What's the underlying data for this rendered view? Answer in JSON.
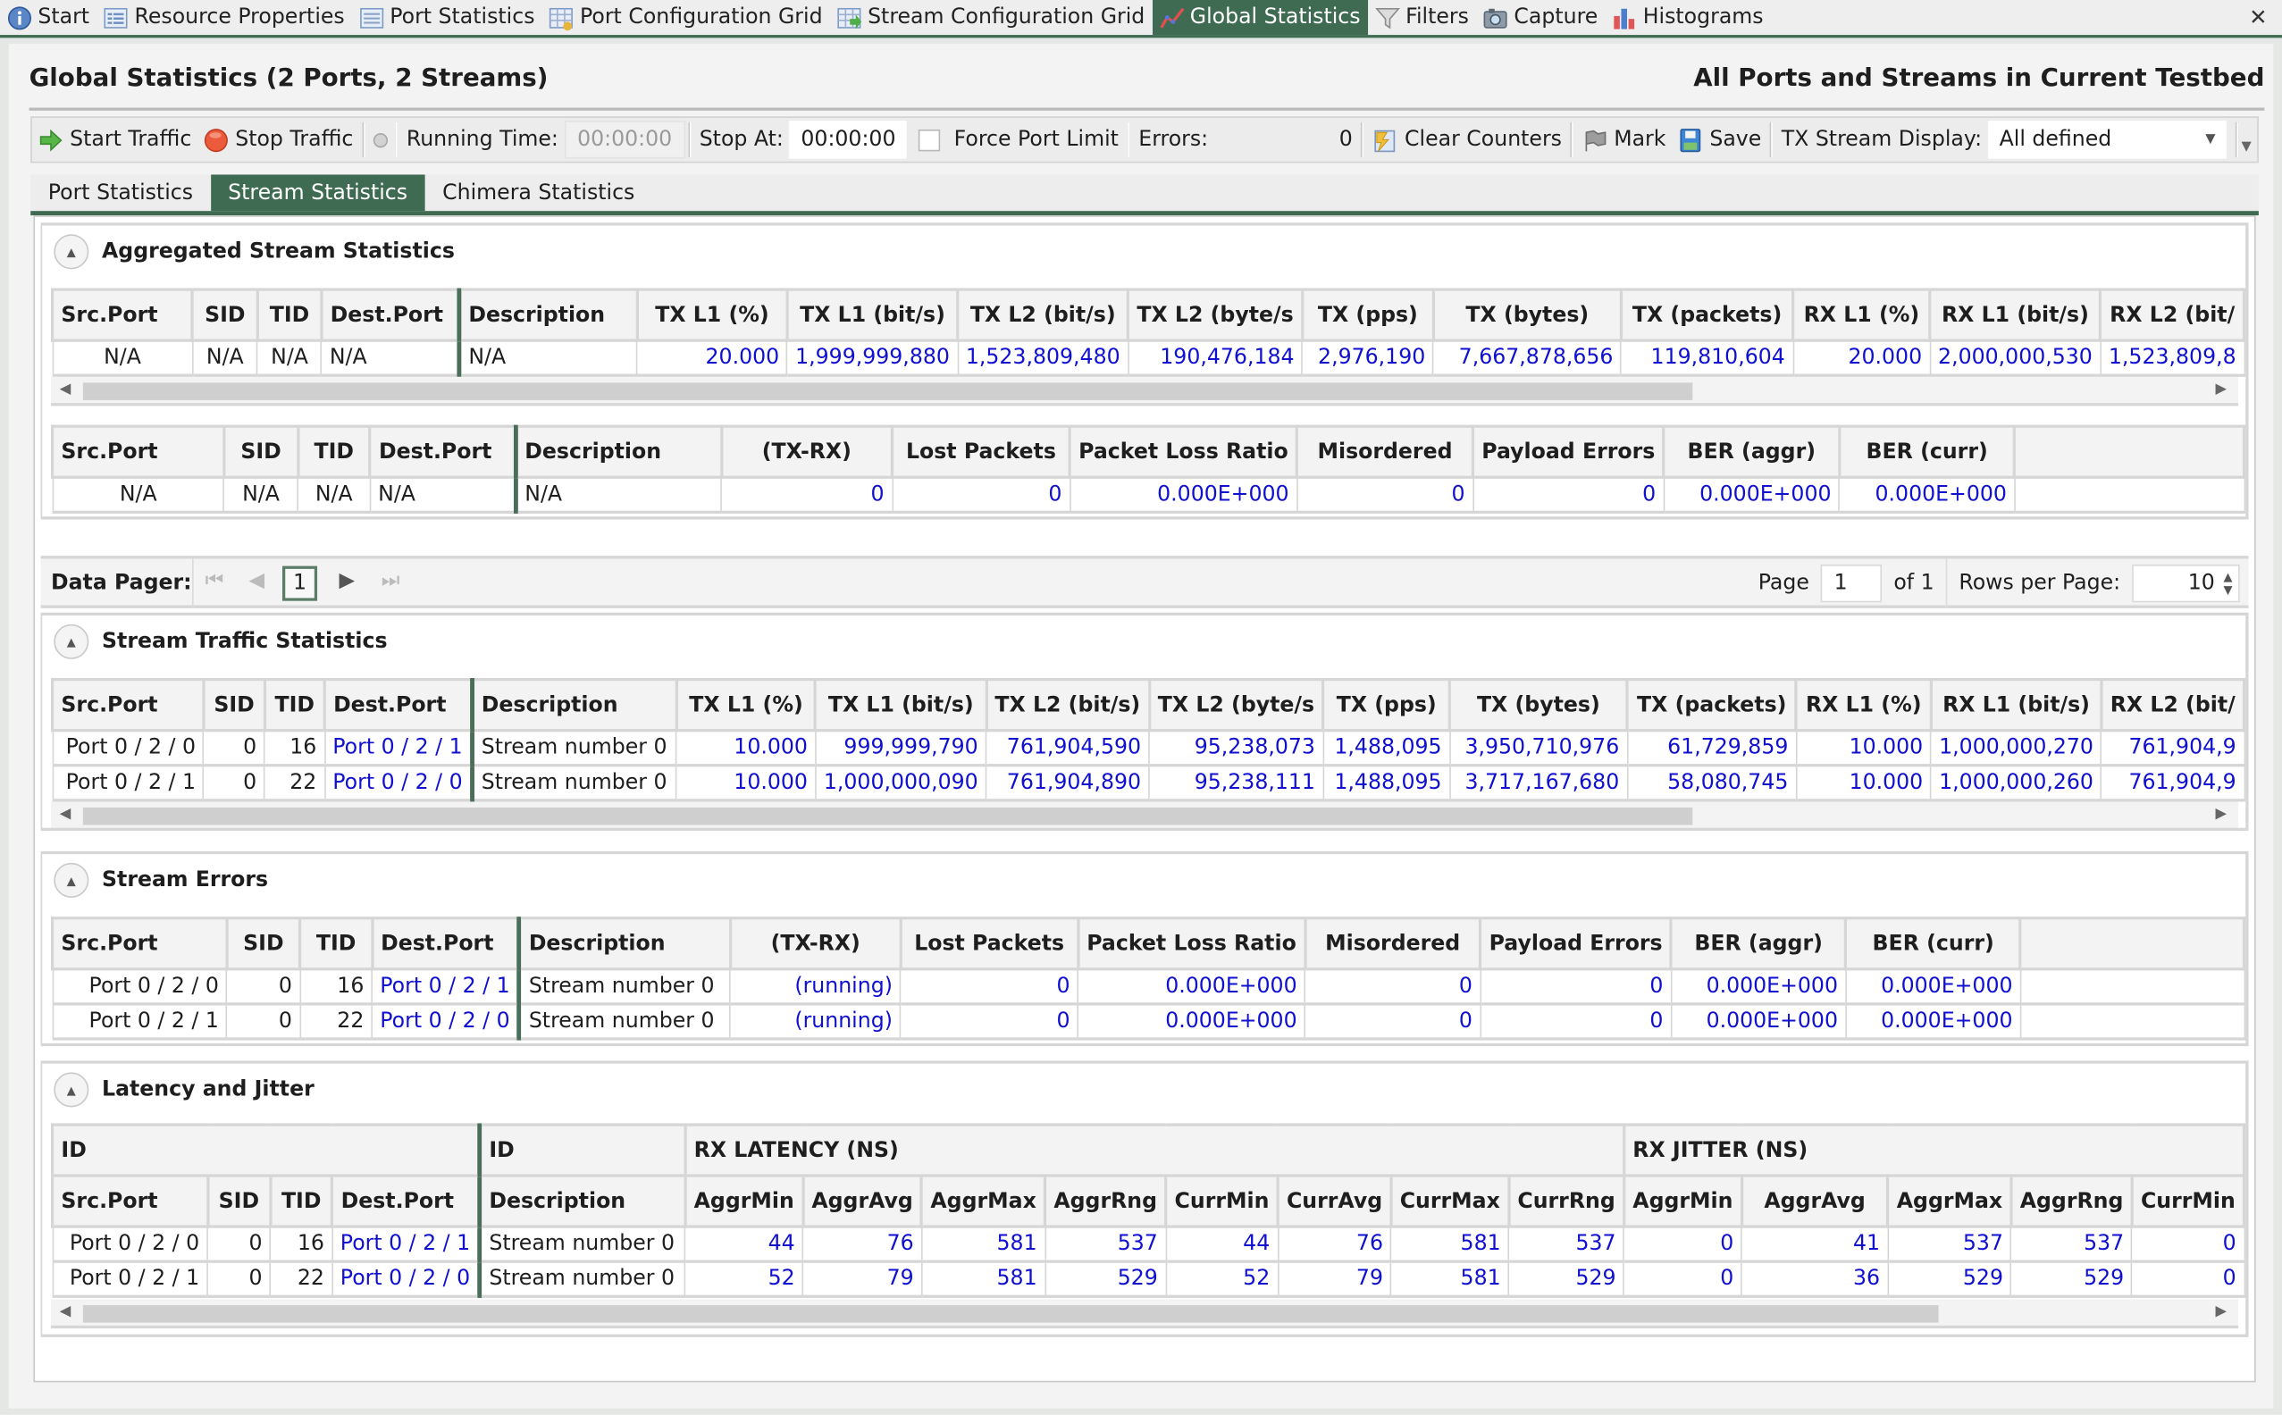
{
  "doc_tabs": [
    {
      "label": "Start",
      "icon": "info-icon",
      "active": false
    },
    {
      "label": "Resource Properties",
      "icon": "properties-icon",
      "active": false
    },
    {
      "label": "Port Statistics",
      "icon": "list-icon",
      "active": false
    },
    {
      "label": "Port Configuration Grid",
      "icon": "grid-config-icon",
      "active": false
    },
    {
      "label": "Stream Configuration Grid",
      "icon": "grid-stream-icon",
      "active": false
    },
    {
      "label": "Global Statistics",
      "icon": "chart-line-icon",
      "active": true
    },
    {
      "label": "Filters",
      "icon": "filter-icon",
      "active": false
    },
    {
      "label": "Capture",
      "icon": "camera-icon",
      "active": false
    },
    {
      "label": "Histograms",
      "icon": "histogram-icon",
      "active": false
    }
  ],
  "close_glyph": "✕",
  "header": {
    "title": "Global Statistics (2 Ports, 2 Streams)",
    "scope": "All Ports and Streams in Current Testbed"
  },
  "toolbar": {
    "start_traffic": "Start Traffic",
    "stop_traffic": "Stop Traffic",
    "running_time_label": "Running Time:",
    "running_time_value": "00:00:00",
    "stop_at_label": "Stop At:",
    "stop_at_value": "00:00:00",
    "force_port_limit": "Force Port Limit",
    "force_port_limit_checked": false,
    "errors_label": "Errors:",
    "errors_value": "0",
    "clear_counters": "Clear Counters",
    "mark": "Mark",
    "save": "Save",
    "tx_stream_display_label": "TX Stream Display:",
    "tx_stream_display_value": "All defined"
  },
  "sub_tabs": [
    {
      "label": "Port Statistics",
      "active": false
    },
    {
      "label": "Stream Statistics",
      "active": true
    },
    {
      "label": "Chimera Statistics",
      "active": false
    }
  ],
  "colors": {
    "accent": "#3e6b52",
    "value_blue": "#1010d0"
  },
  "aggregated": {
    "title": "Aggregated Stream Statistics",
    "traffic_headers": [
      "Src.Port",
      "SID",
      "TID",
      "Dest.Port",
      "Description",
      "TX L1 (%)",
      "TX L1 (bit/s)",
      "TX L2 (bit/s)",
      "TX L2 (byte/s",
      "TX (pps)",
      "TX (bytes)",
      "TX (packets)",
      "RX L1 (%)",
      "RX L1 (bit/s)",
      "RX L2 (bit/"
    ],
    "traffic_rows": [
      [
        "N/A",
        "N/A",
        "N/A",
        "N/A",
        "N/A",
        "20.000",
        "1,999,999,880",
        "1,523,809,480",
        "190,476,184",
        "2,976,190",
        "7,667,878,656",
        "119,810,604",
        "20.000",
        "2,000,000,530",
        "1,523,809,8"
      ]
    ],
    "error_headers": [
      "Src.Port",
      "SID",
      "TID",
      "Dest.Port",
      "Description",
      "(TX-RX)",
      "Lost Packets",
      "Packet Loss Ratio",
      "Misordered",
      "Payload Errors",
      "BER (aggr)",
      "BER (curr)",
      ""
    ],
    "error_rows": [
      [
        "N/A",
        "N/A",
        "N/A",
        "N/A",
        "N/A",
        "0",
        "0",
        "0.000E+000",
        "0",
        "0",
        "0.000E+000",
        "0.000E+000",
        ""
      ]
    ]
  },
  "pager": {
    "label": "Data Pager:",
    "current_page": "1",
    "page_label": "Page",
    "page_value": "1",
    "of_label": "of 1",
    "rows_per_page_label": "Rows per Page:",
    "rows_per_page_value": "10"
  },
  "traffic": {
    "title": "Stream Traffic Statistics",
    "headers": [
      "Src.Port",
      "SID",
      "TID",
      "Dest.Port",
      "Description",
      "TX L1 (%)",
      "TX L1 (bit/s)",
      "TX L2 (bit/s)",
      "TX L2 (byte/s",
      "TX (pps)",
      "TX (bytes)",
      "TX (packets)",
      "RX L1 (%)",
      "RX L1 (bit/s)",
      "RX L2 (bit/"
    ],
    "rows": [
      [
        "Port 0 / 2 / 0",
        "0",
        "16",
        "Port 0 / 2 / 1",
        "Stream number 0",
        "10.000",
        "999,999,790",
        "761,904,590",
        "95,238,073",
        "1,488,095",
        "3,950,710,976",
        "61,729,859",
        "10.000",
        "1,000,000,270",
        "761,904,9"
      ],
      [
        "Port 0 / 2 / 1",
        "0",
        "22",
        "Port 0 / 2 / 0",
        "Stream number 0",
        "10.000",
        "1,000,000,090",
        "761,904,890",
        "95,238,111",
        "1,488,095",
        "3,717,167,680",
        "58,080,745",
        "10.000",
        "1,000,000,260",
        "761,904,9"
      ]
    ]
  },
  "errors": {
    "title": "Stream Errors",
    "headers": [
      "Src.Port",
      "SID",
      "TID",
      "Dest.Port",
      "Description",
      "(TX-RX)",
      "Lost Packets",
      "Packet Loss Ratio",
      "Misordered",
      "Payload Errors",
      "BER (aggr)",
      "BER (curr)",
      ""
    ],
    "rows": [
      [
        "Port 0 / 2 / 0",
        "0",
        "16",
        "Port 0 / 2 / 1",
        "Stream number 0",
        "(running)",
        "0",
        "0.000E+000",
        "0",
        "0",
        "0.000E+000",
        "0.000E+000",
        ""
      ],
      [
        "Port 0 / 2 / 1",
        "0",
        "22",
        "Port 0 / 2 / 0",
        "Stream number 0",
        "(running)",
        "0",
        "0.000E+000",
        "0",
        "0",
        "0.000E+000",
        "0.000E+000",
        ""
      ]
    ]
  },
  "latency": {
    "title": "Latency and Jitter",
    "group_headers": [
      "ID",
      "ID",
      "RX LATENCY (NS)",
      "RX JITTER (NS)"
    ],
    "headers": [
      "Src.Port",
      "SID",
      "TID",
      "Dest.Port",
      "Description",
      "AggrMin",
      "AggrAvg",
      "AggrMax",
      "AggrRng",
      "CurrMin",
      "CurrAvg",
      "CurrMax",
      "CurrRng",
      "AggrMin",
      "AggrAvg",
      "AggrMax",
      "AggrRng",
      "CurrMin"
    ],
    "rows": [
      [
        "Port 0 / 2 / 0",
        "0",
        "16",
        "Port 0 / 2 / 1",
        "Stream number 0",
        "44",
        "76",
        "581",
        "537",
        "44",
        "76",
        "581",
        "537",
        "0",
        "41",
        "537",
        "537",
        "0"
      ],
      [
        "Port 0 / 2 / 1",
        "0",
        "22",
        "Port 0 / 2 / 0",
        "Stream number 0",
        "52",
        "79",
        "581",
        "529",
        "52",
        "79",
        "581",
        "529",
        "0",
        "36",
        "529",
        "529",
        "0"
      ]
    ]
  }
}
